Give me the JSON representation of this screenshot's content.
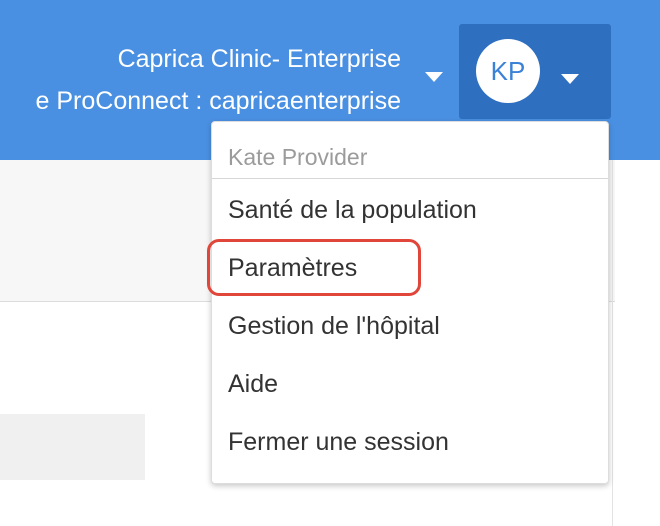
{
  "header": {
    "org_name": "Caprica Clinic- Enterprise",
    "proconnect_line": "e ProConnect : capricaenterprise",
    "user_initials": "KP"
  },
  "user_menu": {
    "user_name": "Kate Provider",
    "items": [
      {
        "label": "Santé de la population"
      },
      {
        "label": "Paramètres"
      },
      {
        "label": "Gestion de l'hôpital"
      },
      {
        "label": "Aide"
      },
      {
        "label": "Fermer une session"
      }
    ]
  },
  "colors": {
    "header_bg": "#4a90e2",
    "user_button_bg": "#2f6fc0",
    "highlight_border": "#e0463a"
  },
  "icons": {
    "org_dropdown": "caret-down-icon",
    "user_dropdown": "caret-down-icon"
  }
}
